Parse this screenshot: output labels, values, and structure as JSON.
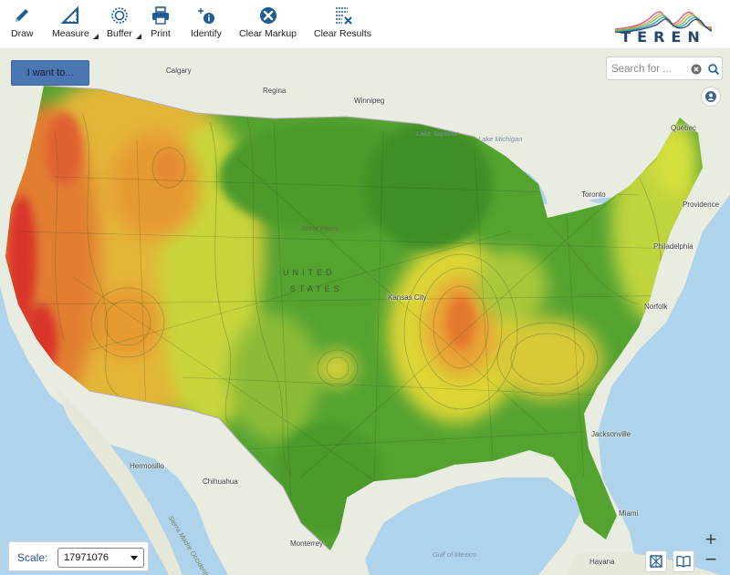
{
  "toolbar": {
    "tools": [
      {
        "label": "Draw",
        "icon": "pencil-icon"
      },
      {
        "label": "Measure",
        "icon": "ruler-icon"
      },
      {
        "label": "Buffer",
        "icon": "buffer-icon"
      },
      {
        "label": "Print",
        "icon": "printer-icon"
      },
      {
        "label": "Identify",
        "icon": "identify-icon"
      },
      {
        "label": "Clear Markup",
        "icon": "clear-icon"
      },
      {
        "label": "Clear Results",
        "icon": "clear-results-icon"
      }
    ]
  },
  "logo": {
    "text": "TEREN"
  },
  "actions": {
    "i_want_to": "I want to..."
  },
  "search": {
    "placeholder": "Search for ..."
  },
  "scale": {
    "label": "Scale:",
    "value": "17971076"
  },
  "map_labels": {
    "calgary": "Calgary",
    "regina": "Regina",
    "winnipeg": "Winnipeg",
    "great_plains": "Great Plains",
    "united": "UNITED",
    "states": "STATES",
    "kansas_city": "Kansas City",
    "lake_superior": "Lake Superior",
    "lake_michigan": "Lake Michigan",
    "toronto": "Toronto",
    "quebec": "Québec",
    "providence": "Providence",
    "philadelphia": "Philadelphia",
    "norfolk": "Norfolk",
    "jacksonville": "Jacksonville",
    "miami": "Miami",
    "havana": "Havana",
    "gulf_of_mexico": "Gulf of Mexico",
    "hermosillo": "Hermosillo",
    "chihuahua": "Chihuahua",
    "monterrey": "Monterrey",
    "sierra_madre": "Sierra Madre Occidental"
  },
  "colors": {
    "accent": "#4a77b1",
    "water": "#aed3ea",
    "land": "#e9ece0",
    "heat_green": "#4c9a2a",
    "heat_yellow": "#d9e23a",
    "heat_orange": "#e69a2c",
    "heat_red": "#d9352b"
  }
}
